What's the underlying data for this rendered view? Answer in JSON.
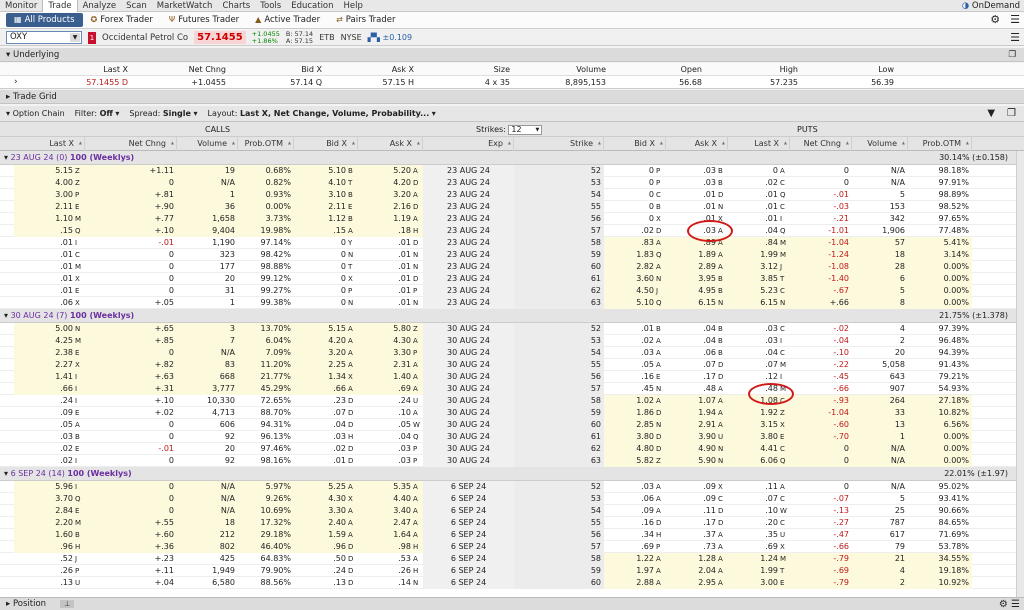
{
  "menu": {
    "items": [
      "Monitor",
      "Trade",
      "Analyze",
      "Scan",
      "MarketWatch",
      "Charts",
      "Tools",
      "Education",
      "Help"
    ],
    "active": 1,
    "ondemand": "OnDemand"
  },
  "tabs": [
    {
      "label": "All Products",
      "icon": "grid-icon",
      "active": true
    },
    {
      "label": "Forex Trader",
      "icon": "globe-icon"
    },
    {
      "label": "Futures Trader",
      "icon": "futures-icon"
    },
    {
      "label": "Active Trader",
      "icon": "active-trader-icon"
    },
    {
      "label": "Pairs Trader",
      "icon": "pairs-icon"
    }
  ],
  "symbol": {
    "ticker": "OXY",
    "badge": "1",
    "company": "Occidental Petrol Co",
    "last": "57.1455",
    "chg1": "+1.0455",
    "chg2": "+1.86%",
    "bid": "B: 57.14",
    "ask": "A: 57.15",
    "etb": "ETB",
    "exchange": "NYSE",
    "delta": "±0.109"
  },
  "underlying": {
    "title": "Underlying",
    "columns": [
      "Last X",
      "Net Chng",
      "Bid X",
      "Ask X",
      "Size",
      "Volume",
      "Open",
      "High",
      "Low"
    ],
    "values": [
      "57.1455 D",
      "+1.0455",
      "57.14 Q",
      "57.15 H",
      "4 x 35",
      "8,895,153",
      "56.68",
      "57.235",
      "56.39"
    ]
  },
  "trade_grid": {
    "title": "Trade Grid"
  },
  "option_chain": {
    "title": "Option Chain",
    "filter_label": "Filter:",
    "filter": "Off",
    "spread_label": "Spread:",
    "spread": "Single",
    "layout_label": "Layout:",
    "layout": "Last X, Net Change, Volume, Probability..."
  },
  "chain_header": {
    "calls": "CALLS",
    "puts": "PUTS",
    "strikes_label": "Strikes:",
    "strikes": "12"
  },
  "columns": {
    "calls": [
      "Last X",
      "Net Chng",
      "Volume",
      "Prob.OTM",
      "Bid X",
      "Ask X"
    ],
    "mid": [
      "Exp",
      "Strike"
    ],
    "puts": [
      "Bid X",
      "Ask X",
      "Last X",
      "Net Chng",
      "Volume",
      "Prob.OTM"
    ]
  },
  "groups": [
    {
      "exp": "23 AUG 24",
      "days": "(0)",
      "mult": "100 (Weeklys)",
      "iv": "30.14% (±0.158)",
      "rows": [
        [
          "5.15",
          "Z",
          "+1.11",
          "19",
          "0.68%",
          "5.10",
          "B",
          "5.20",
          "A",
          "23 AUG 24",
          "52",
          "0",
          "P",
          ".03",
          "B",
          "0",
          "A",
          "0",
          "N/A",
          "98.18%"
        ],
        [
          "4.00",
          "Z",
          "0",
          "N/A",
          "0.82%",
          "4.10",
          "T",
          "4.20",
          "D",
          "23 AUG 24",
          "53",
          "0",
          "P",
          ".03",
          "B",
          ".02",
          "C",
          "0",
          "N/A",
          "97.91%"
        ],
        [
          "3.00",
          "P",
          "+.81",
          "1",
          "0.93%",
          "3.10",
          "B",
          "3.20",
          "A",
          "23 AUG 24",
          "54",
          "0",
          "C",
          ".01",
          "D",
          ".01",
          "Q",
          "-.01",
          "5",
          "98.89%"
        ],
        [
          "2.11",
          "E",
          "+.90",
          "36",
          "0.00%",
          "2.11",
          "E",
          "2.16",
          "D",
          "23 AUG 24",
          "55",
          "0",
          "B",
          ".01",
          "N",
          ".01",
          "C",
          "-.03",
          "153",
          "98.52%"
        ],
        [
          "1.10",
          "M",
          "+.77",
          "1,658",
          "3.73%",
          "1.12",
          "B",
          "1.19",
          "A",
          "23 AUG 24",
          "56",
          "0",
          "X",
          ".01",
          "X",
          ".01",
          "I",
          "-.21",
          "342",
          "97.65%"
        ],
        [
          ".15",
          "Q",
          "+.10",
          "9,404",
          "19.98%",
          ".15",
          "A",
          ".18",
          "H",
          "23 AUG 24",
          "57",
          ".02",
          "D",
          ".03",
          "A",
          ".04",
          "Q",
          "-1.01",
          "1,906",
          "77.48%"
        ],
        [
          ".01",
          "I",
          "-.01",
          "1,190",
          "97.14%",
          "0",
          "Y",
          ".01",
          "D",
          "23 AUG 24",
          "58",
          ".83",
          "A",
          ".89",
          "A",
          ".84",
          "M",
          "-1.04",
          "57",
          "5.41%"
        ],
        [
          ".01",
          "C",
          "0",
          "323",
          "98.42%",
          "0",
          "N",
          ".01",
          "N",
          "23 AUG 24",
          "59",
          "1.83",
          "Q",
          "1.89",
          "A",
          "1.99",
          "M",
          "-1.24",
          "18",
          "3.14%"
        ],
        [
          ".01",
          "M",
          "0",
          "177",
          "98.88%",
          "0",
          "T",
          ".01",
          "N",
          "23 AUG 24",
          "60",
          "2.82",
          "A",
          "2.89",
          "A",
          "3.12",
          "J",
          "-1.08",
          "28",
          "0.00%"
        ],
        [
          ".01",
          "X",
          "0",
          "20",
          "99.12%",
          "0",
          "X",
          ".01",
          "D",
          "23 AUG 24",
          "61",
          "3.60",
          "N",
          "3.95",
          "B",
          "3.85",
          "T",
          "-1.40",
          "6",
          "0.00%"
        ],
        [
          ".01",
          "E",
          "0",
          "31",
          "99.27%",
          "0",
          "P",
          ".01",
          "P",
          "23 AUG 24",
          "62",
          "4.50",
          "J",
          "4.95",
          "B",
          "5.23",
          "C",
          "-.67",
          "5",
          "0.00%"
        ],
        [
          ".06",
          "X",
          "+.05",
          "1",
          "99.38%",
          "0",
          "N",
          ".01",
          "N",
          "23 AUG 24",
          "63",
          "5.10",
          "Q",
          "6.15",
          "N",
          "6.15",
          "N",
          "+.66",
          "8",
          "0.00%"
        ]
      ]
    },
    {
      "exp": "30 AUG 24",
      "days": "(7)",
      "mult": "100 (Weeklys)",
      "iv": "21.75% (±1.378)",
      "rows": [
        [
          "5.00",
          "N",
          "+.65",
          "3",
          "13.70%",
          "5.15",
          "A",
          "5.80",
          "Z",
          "30 AUG 24",
          "52",
          ".01",
          "B",
          ".04",
          "B",
          ".03",
          "C",
          "-.02",
          "4",
          "97.39%"
        ],
        [
          "4.25",
          "M",
          "+.85",
          "7",
          "6.04%",
          "4.20",
          "A",
          "4.30",
          "A",
          "30 AUG 24",
          "53",
          ".02",
          "A",
          ".04",
          "B",
          ".03",
          "I",
          "-.04",
          "2",
          "96.48%"
        ],
        [
          "2.38",
          "E",
          "0",
          "N/A",
          "7.09%",
          "3.20",
          "A",
          "3.30",
          "P",
          "30 AUG 24",
          "54",
          ".03",
          "A",
          ".06",
          "B",
          ".04",
          "C",
          "-.10",
          "20",
          "94.39%"
        ],
        [
          "2.27",
          "X",
          "+.82",
          "83",
          "11.20%",
          "2.25",
          "A",
          "2.31",
          "A",
          "30 AUG 24",
          "55",
          ".05",
          "A",
          ".07",
          "D",
          ".07",
          "M",
          "-.22",
          "5,058",
          "91.43%"
        ],
        [
          "1.41",
          "I",
          "+.63",
          "668",
          "21.77%",
          "1.34",
          "X",
          "1.40",
          "A",
          "30 AUG 24",
          "56",
          ".16",
          "E",
          ".17",
          "D",
          ".12",
          "I",
          "-.45",
          "643",
          "79.21%"
        ],
        [
          ".66",
          "I",
          "+.31",
          "3,777",
          "45.29%",
          ".66",
          "A",
          ".69",
          "A",
          "30 AUG 24",
          "57",
          ".45",
          "N",
          ".48",
          "A",
          ".48",
          "M",
          "-.66",
          "907",
          "54.93%"
        ],
        [
          ".24",
          "I",
          "+.10",
          "10,330",
          "72.65%",
          ".23",
          "D",
          ".24",
          "U",
          "30 AUG 24",
          "58",
          "1.02",
          "A",
          "1.07",
          "A",
          "1.08",
          "C",
          "-.93",
          "264",
          "27.18%"
        ],
        [
          ".09",
          "E",
          "+.02",
          "4,713",
          "88.70%",
          ".07",
          "D",
          ".10",
          "A",
          "30 AUG 24",
          "59",
          "1.86",
          "D",
          "1.94",
          "A",
          "1.92",
          "Z",
          "-1.04",
          "33",
          "10.82%"
        ],
        [
          ".05",
          "A",
          "0",
          "606",
          "94.31%",
          ".04",
          "D",
          ".05",
          "W",
          "30 AUG 24",
          "60",
          "2.85",
          "N",
          "2.91",
          "A",
          "3.15",
          "X",
          "-.60",
          "13",
          "6.56%"
        ],
        [
          ".03",
          "B",
          "0",
          "92",
          "96.13%",
          ".03",
          "H",
          ".04",
          "Q",
          "30 AUG 24",
          "61",
          "3.80",
          "D",
          "3.90",
          "U",
          "3.80",
          "E",
          "-.70",
          "1",
          "0.00%"
        ],
        [
          ".02",
          "E",
          "-.01",
          "20",
          "97.46%",
          ".02",
          "D",
          ".03",
          "P",
          "30 AUG 24",
          "62",
          "4.80",
          "D",
          "4.90",
          "N",
          "4.41",
          "C",
          "0",
          "N/A",
          "0.00%"
        ],
        [
          ".02",
          "I",
          "0",
          "92",
          "98.16%",
          ".01",
          "D",
          ".03",
          "P",
          "30 AUG 24",
          "63",
          "5.82",
          "Z",
          "5.90",
          "N",
          "6.06",
          "Q",
          "0",
          "N/A",
          "0.00%"
        ]
      ]
    },
    {
      "exp": "6 SEP 24",
      "days": "(14)",
      "mult": "100 (Weeklys)",
      "iv": "22.01% (±1.97)",
      "rows": [
        [
          "5.96",
          "I",
          "0",
          "N/A",
          "5.97%",
          "5.25",
          "A",
          "5.35",
          "A",
          "6 SEP 24",
          "52",
          ".03",
          "A",
          ".09",
          "X",
          ".11",
          "A",
          "0",
          "N/A",
          "95.02%"
        ],
        [
          "3.70",
          "Q",
          "0",
          "N/A",
          "9.26%",
          "4.30",
          "X",
          "4.40",
          "A",
          "6 SEP 24",
          "53",
          ".06",
          "A",
          ".09",
          "C",
          ".07",
          "C",
          "-.07",
          "5",
          "93.41%"
        ],
        [
          "2.84",
          "E",
          "0",
          "N/A",
          "10.69%",
          "3.30",
          "A",
          "3.40",
          "A",
          "6 SEP 24",
          "54",
          ".09",
          "A",
          ".11",
          "D",
          ".10",
          "W",
          "-.13",
          "25",
          "90.66%"
        ],
        [
          "2.20",
          "M",
          "+.55",
          "18",
          "17.32%",
          "2.40",
          "A",
          "2.47",
          "A",
          "6 SEP 24",
          "55",
          ".16",
          "D",
          ".17",
          "D",
          ".20",
          "C",
          "-.27",
          "787",
          "84.65%"
        ],
        [
          "1.60",
          "B",
          "+.60",
          "212",
          "29.18%",
          "1.59",
          "A",
          "1.64",
          "A",
          "6 SEP 24",
          "56",
          ".34",
          "H",
          ".37",
          "A",
          ".35",
          "U",
          "-.47",
          "617",
          "71.69%"
        ],
        [
          ".96",
          "H",
          "+.36",
          "802",
          "46.40%",
          ".96",
          "D",
          ".98",
          "H",
          "6 SEP 24",
          "57",
          ".69",
          "P",
          ".73",
          "A",
          ".69",
          "X",
          "-.66",
          "79",
          "53.78%"
        ],
        [
          ".52",
          "J",
          "+.23",
          "425",
          "64.83%",
          ".50",
          "D",
          ".53",
          "A",
          "6 SEP 24",
          "58",
          "1.22",
          "A",
          "1.28",
          "A",
          "1.24",
          "M",
          "-.79",
          "21",
          "34.55%"
        ],
        [
          ".26",
          "P",
          "+.11",
          "1,949",
          "79.90%",
          ".24",
          "D",
          ".26",
          "H",
          "6 SEP 24",
          "59",
          "1.97",
          "A",
          "2.04",
          "A",
          "1.99",
          "T",
          "-.69",
          "4",
          "19.18%"
        ],
        [
          ".13",
          "U",
          "+.04",
          "6,580",
          "88.56%",
          ".13",
          "D",
          ".14",
          "N",
          "6 SEP 24",
          "60",
          "2.88",
          "A",
          "2.95",
          "A",
          "3.00",
          "E",
          "-.79",
          "2",
          "10.92%"
        ]
      ]
    }
  ],
  "bottom": {
    "label": "Position"
  }
}
